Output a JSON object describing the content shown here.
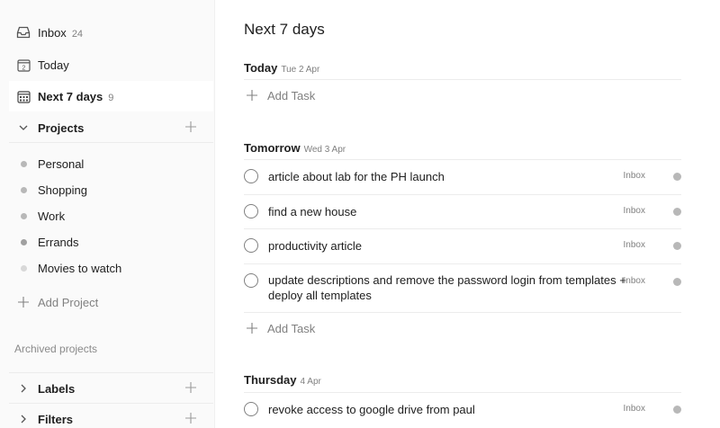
{
  "nav": {
    "inbox": {
      "label": "Inbox",
      "count": "24",
      "icon": "inbox-icon"
    },
    "today": {
      "label": "Today",
      "icon": "calendar-day-icon",
      "day_number": "2"
    },
    "next7": {
      "label": "Next 7 days",
      "count": "9",
      "icon": "calendar-week-icon"
    }
  },
  "projects_section": {
    "title": "Projects",
    "items": [
      {
        "label": "Personal",
        "color": "#b8b8b8"
      },
      {
        "label": "Shopping",
        "color": "#b8b8b8"
      },
      {
        "label": "Work",
        "color": "#b8b8b8"
      },
      {
        "label": "Errands",
        "color": "#a0a0a0"
      },
      {
        "label": "Movies to watch",
        "color": "#d8d8d8"
      }
    ],
    "add_label": "Add Project",
    "archived_label": "Archived projects"
  },
  "labels_section": {
    "title": "Labels"
  },
  "filters_section": {
    "title": "Filters"
  },
  "main": {
    "title": "Next 7 days",
    "days": [
      {
        "name": "Today",
        "date": "Tue 2 Apr",
        "add_task_label": "Add Task",
        "tasks": []
      },
      {
        "name": "Tomorrow",
        "date": "Wed 3 Apr",
        "add_task_label": "Add Task",
        "tasks": [
          {
            "content": "article about lab for the PH launch",
            "project": "Inbox"
          },
          {
            "content": "find a new house",
            "project": "Inbox"
          },
          {
            "content": "productivity article",
            "project": "Inbox"
          },
          {
            "content": "update descriptions and remove the password login from templates + deploy all templates",
            "project": "Inbox"
          }
        ]
      },
      {
        "name": "Thursday",
        "date": "4 Apr",
        "tasks": [
          {
            "content": "revoke access to google drive from paul",
            "project": "Inbox"
          }
        ]
      }
    ]
  },
  "colors": {
    "accent": "#202020",
    "muted": "#808080",
    "project_dot": "#b8b8b8",
    "sidebar_bg": "#fafafa"
  }
}
